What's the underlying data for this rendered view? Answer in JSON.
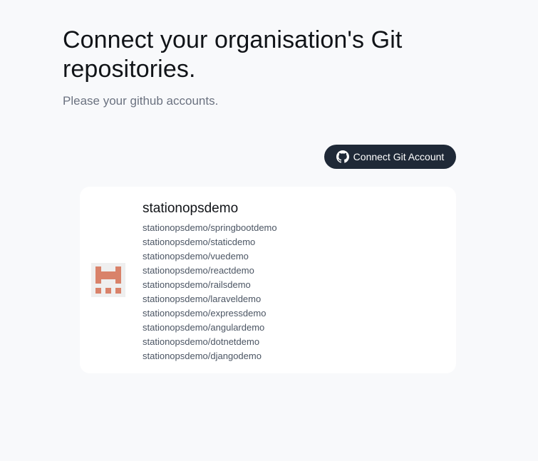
{
  "header": {
    "title": "Connect your organisation's Git repositories.",
    "subtitle": "Please your github accounts."
  },
  "actions": {
    "connect_label": "Connect Git Account",
    "connect_icon": "github-icon"
  },
  "account": {
    "name": "stationopsdemo",
    "avatar_icon": "identicon-avatar",
    "avatar_color": "#d9826a",
    "repos": [
      "stationopsdemo/springbootdemo",
      "stationopsdemo/staticdemo",
      "stationopsdemo/vuedemo",
      "stationopsdemo/reactdemo",
      "stationopsdemo/railsdemo",
      "stationopsdemo/laraveldemo",
      "stationopsdemo/expressdemo",
      "stationopsdemo/angulardemo",
      "stationopsdemo/dotnetdemo",
      "stationopsdemo/djangodemo"
    ]
  },
  "colors": {
    "background": "#f8f9fb",
    "button": "#1f2937",
    "card": "#ffffff"
  }
}
